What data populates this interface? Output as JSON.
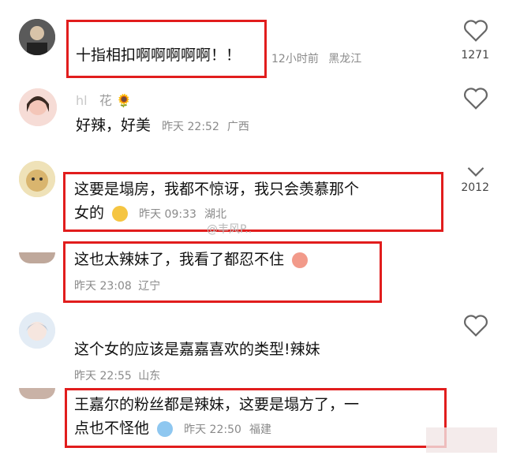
{
  "comments": [
    {
      "text": "十指相扣啊啊啊啊啊！！",
      "time": "12小时前",
      "location": "黑龙江",
      "likes": "1271"
    },
    {
      "username": "花",
      "username_emoji": "🌻",
      "text": "好辣，好美",
      "time": "昨天 22:52",
      "location": "广西"
    },
    {
      "text_line1": "这要是塌房，我都不惊讶，我只会羡慕那个",
      "text_line2": "女的",
      "time": "昨天 09:33",
      "location": "湖北",
      "likes": "2012"
    },
    {
      "text": "这也太辣妹了，我看了都忍不住",
      "time": "昨天 23:08",
      "location": "辽宁"
    },
    {
      "text": "这个女的应该是嘉嘉喜欢的类型!辣妹",
      "time": "昨天 22:55",
      "location": "山东"
    },
    {
      "text_line1": "王嘉尔的粉丝都是辣妹，这要是塌方了，一",
      "text_line2": "点也不怪他",
      "time": "昨天 22:50",
      "location": "福建"
    }
  ],
  "watermark": "@丰风P.."
}
